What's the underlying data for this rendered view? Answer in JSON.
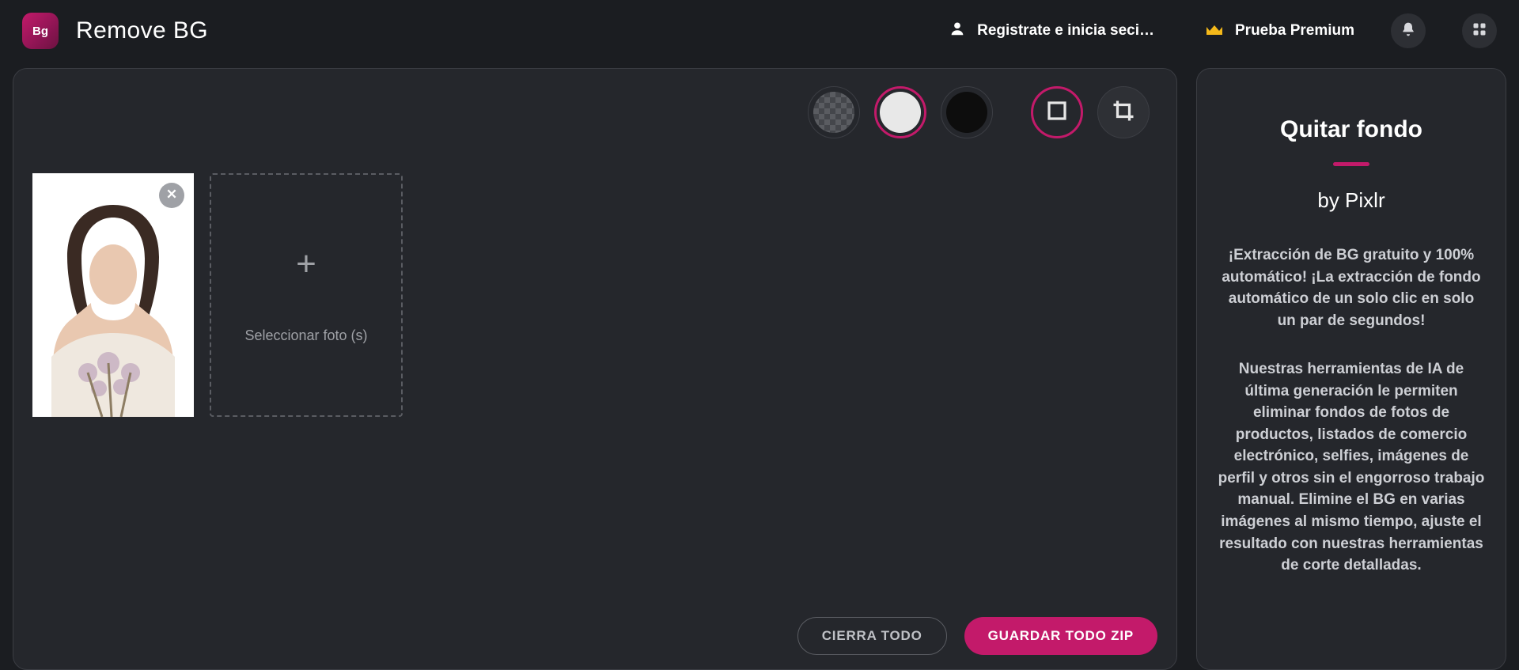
{
  "header": {
    "logo_text": "Bg",
    "title": "Remove BG",
    "login_label": "Registrate e inicia seci…",
    "premium_label": "Prueba Premium"
  },
  "toolbar": {
    "bg_options": [
      "transparent",
      "white",
      "black"
    ],
    "selected_bg": "white",
    "aspect_selected": true
  },
  "thumbs": {
    "add_label": "Seleccionar foto (s)"
  },
  "actions": {
    "close_all": "CIERRA TODO",
    "save_zip": "GUARDAR TODO ZIP"
  },
  "sidebar": {
    "title": "Quitar fondo",
    "subtitle": "by Pixlr",
    "p1": "¡Extracción de BG gratuito y 100% automático! ¡La extracción de fondo automático de un solo clic en solo un par de segundos!",
    "p2": "Nuestras herramientas de IA de última generación le permiten eliminar fondos de fotos de productos, listados de comercio electrónico, selfies, imágenes de perfil y otros sin el engorroso trabajo manual. Elimine el BG en varias imágenes al mismo tiempo, ajuste el resultado con nuestras herramientas de corte detalladas."
  },
  "colors": {
    "accent": "#c31a6a"
  }
}
